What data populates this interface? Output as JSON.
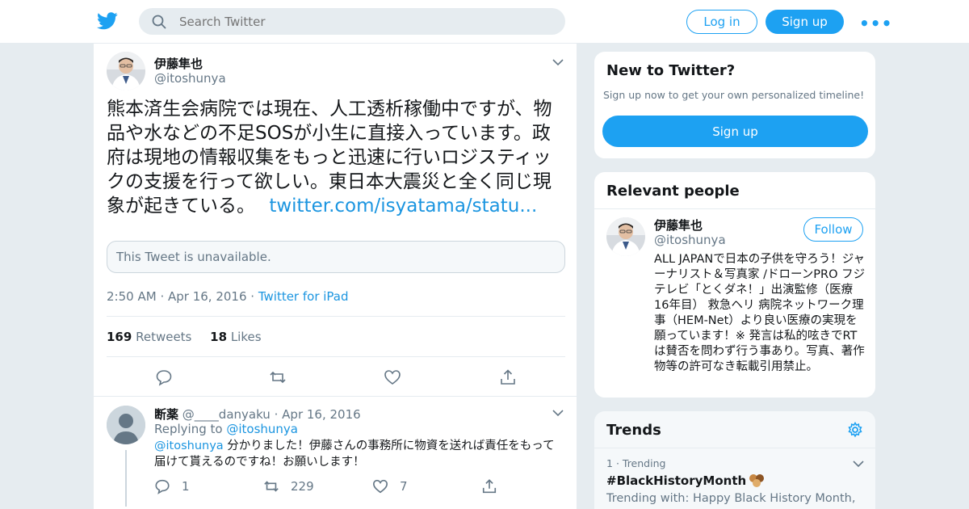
{
  "nav": {
    "search_placeholder": "Search Twitter",
    "login_label": "Log in",
    "signup_label": "Sign up",
    "more_label": "•••"
  },
  "tweet": {
    "name": "伊藤隼也",
    "handle": "@itoshunya",
    "text": "熊本済生会病院では現在、人工透析稼働中ですが、物品や水などの不足SOSが小生に直接入っています。政府は現地の情報収集をもっと迅速に行いロジスティックの支援を行って欲しい。東日本大震災と全く同じ現象が起きている。",
    "link_text": "twitter.com/isyatama/statu...",
    "quote_unavailable": "This Tweet is unavailable.",
    "time": "2:50 AM",
    "date": "Apr 16, 2016",
    "source": "Twitter for iPad",
    "retweets_count": "169",
    "retweets_label": "Retweets",
    "likes_count": "18",
    "likes_label": "Likes"
  },
  "reply": {
    "name": "断薬",
    "handle": "@____danyaku",
    "date": "Apr 16, 2016",
    "replying_to_label": "Replying to",
    "replying_to_handle": "@itoshunya",
    "mention": "@itoshunya",
    "text": "分かりました！伊藤さんの事務所に物資を送れば責任をもって届けて貰えるのですね！お願いします！",
    "replies_count": "1",
    "retweets_count": "229",
    "likes_count": "7"
  },
  "sidebar": {
    "new_title": "New to Twitter?",
    "new_sub": "Sign up now to get your own personalized timeline!",
    "new_signup": "Sign up",
    "relevant_title": "Relevant people",
    "person_name": "伊藤隼也",
    "person_handle": "@itoshunya",
    "follow_label": "Follow",
    "person_bio": "ALL JAPANで日本の子供を守ろう！ジャーナリスト＆写真家 /ドローンPRO フジテレビ「とくダネ！」出演監修（医療 16年目） 救急ヘリ 病院ネットワーク理事（HEM-Net）より良い医療の実現を願っています！※ 発言は私的呟きでRTは賛否を問わず行う事あり。写真、著作物等の許可なき転載引用禁止。",
    "trends_title": "Trends",
    "trend_rank": "1",
    "trend_meta": "Trending",
    "trend_tag": "#BlackHistoryMonth",
    "trend_with": "Trending with: Happy Black History Month,"
  },
  "colors": {
    "brand": "#1da1f2",
    "link": "#1b95e0",
    "muted": "#657786",
    "background": "#e6ecf0"
  }
}
